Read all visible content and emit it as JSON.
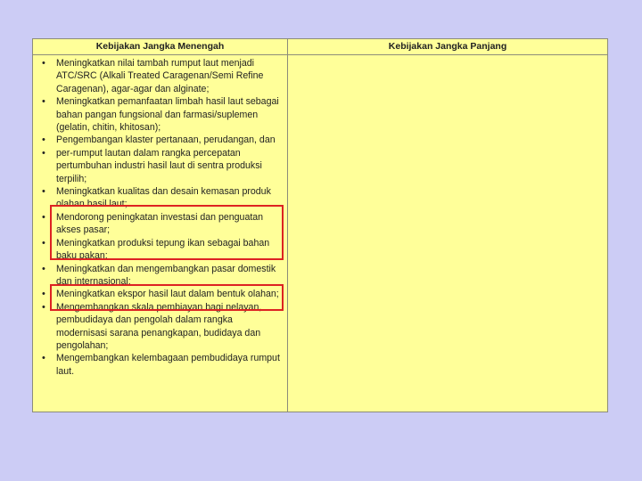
{
  "table": {
    "header_left": "Kebijakan Jangka Menengah",
    "header_right": "Kebijakan Jangka Panjang",
    "items": [
      "Meningkatkan nilai tambah rumput laut menjadi ATC/SRC (Alkali Treated Caragenan/Semi Refine Caragenan), agar-agar dan alginate;",
      "Meningkatkan pemanfaatan limbah hasil laut sebagai bahan pangan fungsional dan farmasi/suplemen (gelatin, chitin, khitosan);",
      "Pengembangan klaster pertanaan, perudangan, dan",
      "per-rumput lautan dalam rangka percepatan pertumbuhan industri hasil laut di sentra produksi terpilih;",
      "Meningkatkan kualitas dan desain kemasan produk olahan hasil laut;",
      "Mendorong peningkatan investasi dan penguatan akses pasar;",
      "Meningkatkan produksi tepung ikan sebagai bahan baku pakan;",
      "Meningkatkan dan mengembangkan pasar domestik dan internasional;",
      "Meningkatkan ekspor hasil laut dalam bentuk olahan;",
      "Mengembangkan skala pembiayan bagi nelayan, pembudidaya dan pengolah dalam rangka modernisasi sarana penangkapan, budidaya dan pengolahan;",
      "Mengembangkan kelembagaan pembudidaya rumput laut."
    ]
  },
  "colors": {
    "background": "#ccccf5",
    "table_fill": "#ffff99",
    "highlight": "#dd2222"
  }
}
